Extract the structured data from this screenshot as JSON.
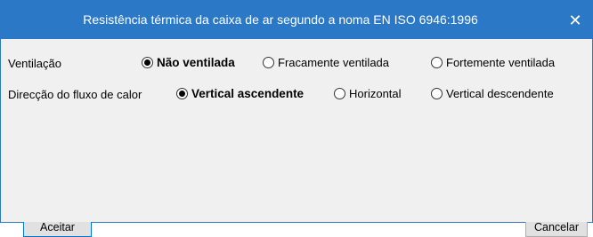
{
  "dialog": {
    "title": "Resistência térmica da caixa de ar segundo a noma EN ISO 6946:1996",
    "close_glyph": "✕"
  },
  "ventilation": {
    "label": "Ventilação",
    "options": [
      {
        "label": "Não ventilada",
        "checked": true
      },
      {
        "label": "Fracamente ventilada",
        "checked": false
      },
      {
        "label": "Fortemente ventilada",
        "checked": false
      }
    ]
  },
  "heat_flow": {
    "label": "Direcção do fluxo de calor",
    "options": [
      {
        "label": "Vertical ascendente",
        "checked": true
      },
      {
        "label": "Horizontal",
        "checked": false
      },
      {
        "label": "Vertical descendente",
        "checked": false
      }
    ]
  },
  "buttons": {
    "accept": "Aceitar",
    "cancel": "Cancelar"
  },
  "colors": {
    "titlebar": "#2b78c7",
    "body": "#f0f0f0"
  }
}
